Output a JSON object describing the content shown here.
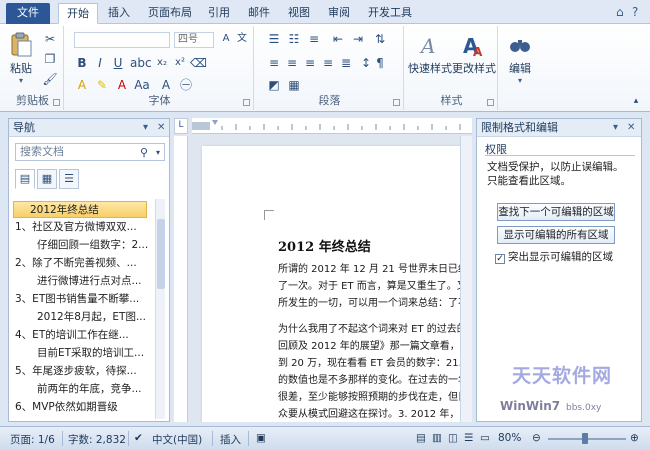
{
  "tabs": [
    "文件",
    "开始",
    "插入",
    "页面布局",
    "引用",
    "邮件",
    "视图",
    "审阅",
    "开发工具"
  ],
  "active_tab": "开始",
  "ribbon": {
    "clipboard": {
      "paste": "粘贴",
      "label": "剪贴板"
    },
    "font": {
      "size_value": "四号",
      "label": "字体"
    },
    "paragraph": {
      "label": "段落"
    },
    "styles": {
      "quick_styles": "快速样式",
      "change_styles": "更改样式",
      "label": "样式"
    },
    "editing": {
      "edit": "编辑"
    }
  },
  "nav_pane": {
    "title": "导航",
    "search_placeholder": "搜索文档",
    "items": [
      "2012年终总结",
      "1、社区及官方微博双双...",
      "仔细回顾一组数字：2...",
      "2、除了不断完善视频、...",
      "进行微博进行点对点...",
      "3、ET图书销售量不断攀...",
      "2012年8月起，ET图...",
      "4、ET的培训工作在继...",
      "目前ET采取的培训工...",
      "5、年尾逐步疲软，待探...",
      "前两年的年底，竞争...",
      "6、MVP依然如期晋级"
    ]
  },
  "document": {
    "title": "2012 年终总结",
    "paragraphs": [
      "所谓的 2012 年 12 月 21 号世界末日已经过了",
      "了一次。对于 ET 而言，算是又重生了。又到",
      "所发生的一切，可以用一个词来总结：了不起",
      "为什么我用了不起这个词来对 ET 的过去的一年",
      "回顾及 2012 年的展望》那一篇文章看，当初",
      "到 20 万，现在看看 ET 会员的数字：21.1万，",
      "的数值也是不多那样的变化。在过去的一年",
      "很差，至少能够按照预期的步伐在走，但目前",
      "众要从模式回避这在探讨。3. 2012 年，ET 持续"
    ]
  },
  "restrict_pane": {
    "title": "限制格式和编辑",
    "heading": "权限",
    "desc_line1": "文档受保护，以防止误编辑。",
    "desc_line2": "只能查看此区域。",
    "btn_find_next": "查找下一个可编辑的区域",
    "btn_show_all": "显示可编辑的所有区域",
    "highlight_label": "突出显示可编辑的区域"
  },
  "status_bar": {
    "page": "页面: 1/6",
    "word_count": "字数: 2,832",
    "language": "中文(中国)",
    "insert_mode": "插入",
    "zoom": "80%"
  },
  "watermark": {
    "site": "天天软件网",
    "logo": "WinWin7",
    "url": "bbs.0xy"
  }
}
